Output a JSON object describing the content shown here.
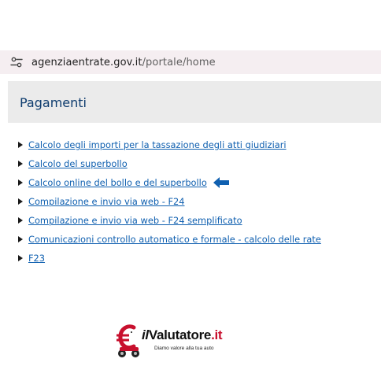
{
  "address_bar": {
    "icon": "tune-icon",
    "url_domain": "agenziaentrate.gov.it",
    "url_path": "/portale/home"
  },
  "section": {
    "title": "Pagamenti"
  },
  "links": [
    {
      "label": "Calcolo degli importi per la tassazione degli atti giudiziari"
    },
    {
      "label": "Calcolo del superbollo"
    },
    {
      "label": "Calcolo online del bollo e del superbollo",
      "highlighted": true
    },
    {
      "label": "Compilazione e invio via web - F24"
    },
    {
      "label": "Compilazione e invio via web - F24 semplificato"
    },
    {
      "label": "Comunicazioni controllo automatico e formale - calcolo delle rate"
    },
    {
      "label": "F23"
    }
  ],
  "pointer_arrow": {
    "icon": "left-arrow-icon",
    "color": "#1060b0"
  },
  "logo": {
    "prefix": "il",
    "name": "Valutatore",
    "tld": ".it",
    "tagline": "Diamo valore alla tua auto",
    "accent_color": "#c8102e"
  },
  "colors": {
    "link": "#1060b0",
    "header_bg": "#ebebeb",
    "header_text": "#0e3c6e",
    "address_bg": "#f5eef1"
  }
}
